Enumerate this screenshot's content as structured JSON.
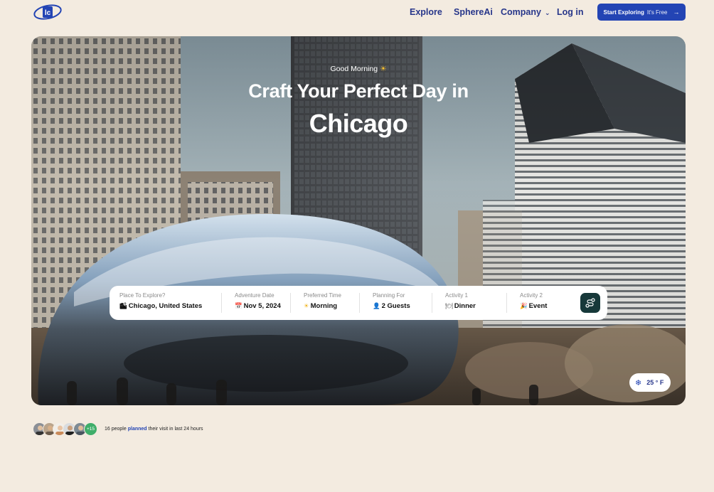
{
  "nav": {
    "logo_text": "lc",
    "links": [
      "Explore",
      "SphereAi",
      "Company",
      "Log in"
    ],
    "cta_strong": "Start Exploring",
    "cta_light": "It's Free"
  },
  "hero": {
    "greeting": "Good Morning",
    "title_line1": "Craft Your Perfect Day in",
    "title_line2": "Chicago"
  },
  "search": {
    "fields": [
      {
        "label": "Place To Explore?",
        "value": "Chicago, United States",
        "icon": "city-icon"
      },
      {
        "label": "Adventure Date",
        "value": "Nov 5, 2024",
        "icon": "calendar-icon"
      },
      {
        "label": "Preferred Time",
        "value": "Morning",
        "icon": "sun-icon"
      },
      {
        "label": "Planning For",
        "value": "2 Guests",
        "icon": "person-icon"
      },
      {
        "label": "Activity 1",
        "value": "Dinner",
        "icon": "dinner-icon"
      },
      {
        "label": "Activity 2",
        "value": "Event",
        "icon": "event-icon"
      }
    ],
    "button_icon": "route-icon"
  },
  "weather": {
    "temp": "25 ° F",
    "icon": "snowflake-icon"
  },
  "social": {
    "more_count": "+15",
    "text_before": "16 people",
    "highlight": "planned",
    "text_after": "their visit in last 24 hours"
  },
  "colors": {
    "background": "#f3ebe0",
    "brand": "#2344b4",
    "nav_text": "#27368a",
    "go_button": "#17393a",
    "avatar_more": "#3fae6a"
  }
}
